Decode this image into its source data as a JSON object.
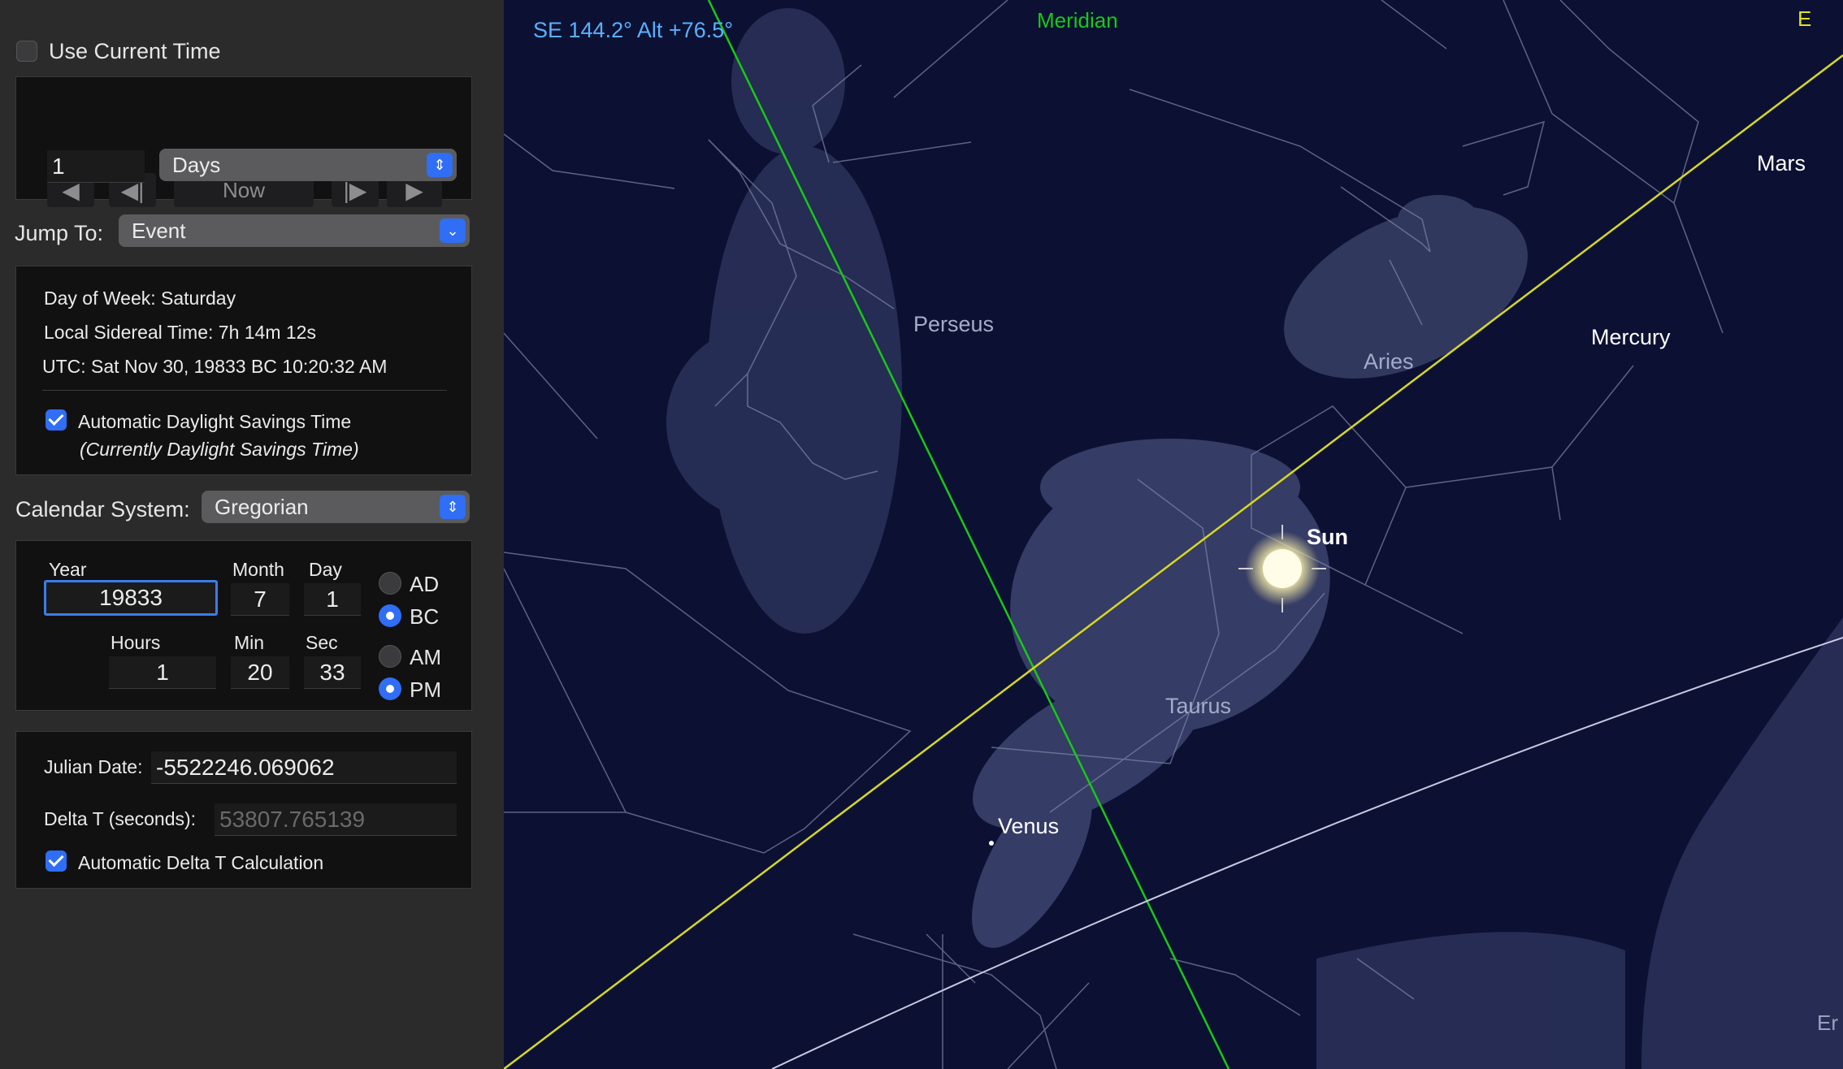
{
  "panel": {
    "use_current_time": "Use Current Time",
    "nav": {
      "prev": "◀",
      "step_back": "◀|",
      "now": "Now",
      "step_fwd": "|▶",
      "next": "▶"
    },
    "step_value": "1",
    "step_unit": "Days",
    "jump_to_label": "Jump To:",
    "jump_to_value": "Event",
    "day_of_week": "Day of Week:  Saturday",
    "sidereal": "Local Sidereal Time:  7h 14m 12s",
    "utc": "UTC:  Sat Nov 30, 19833 BC 10:20:32 AM",
    "dst_label": "Automatic Daylight Savings Time",
    "dst_note": "(Currently Daylight Savings Time)",
    "calendar_label": "Calendar System:",
    "calendar_value": "Gregorian",
    "year_label": "Year",
    "year": "19833",
    "month_label": "Month",
    "month": "7",
    "day_label": "Day",
    "day": "1",
    "hours_label": "Hours",
    "hours": "1",
    "min_label": "Min",
    "min": "20",
    "sec_label": "Sec",
    "sec": "33",
    "ad": "AD",
    "bc": "BC",
    "am": "AM",
    "pm": "PM",
    "julian_label": "Julian Date:",
    "julian": "-5522246.069062",
    "delta_t_label": "Delta T (seconds):",
    "delta_t": "53807.765139",
    "auto_delta_label": "Automatic Delta T Calculation"
  },
  "sky": {
    "direction": "SE 144.2° Alt +76.5°",
    "meridian": "Meridian",
    "ecliptic_edge": "E",
    "equator_edge": "Er",
    "constellations": {
      "perseus": "Perseus",
      "aries": "Aries",
      "taurus": "Taurus"
    },
    "planets": {
      "sun": "Sun",
      "mars": "Mars",
      "mercury": "Mercury",
      "venus": "Venus"
    },
    "colors": {
      "meridian": "#18c818",
      "ecliptic": "#d8d820",
      "equator": "#c8c8e0",
      "direction": "#5ab0ff"
    }
  }
}
